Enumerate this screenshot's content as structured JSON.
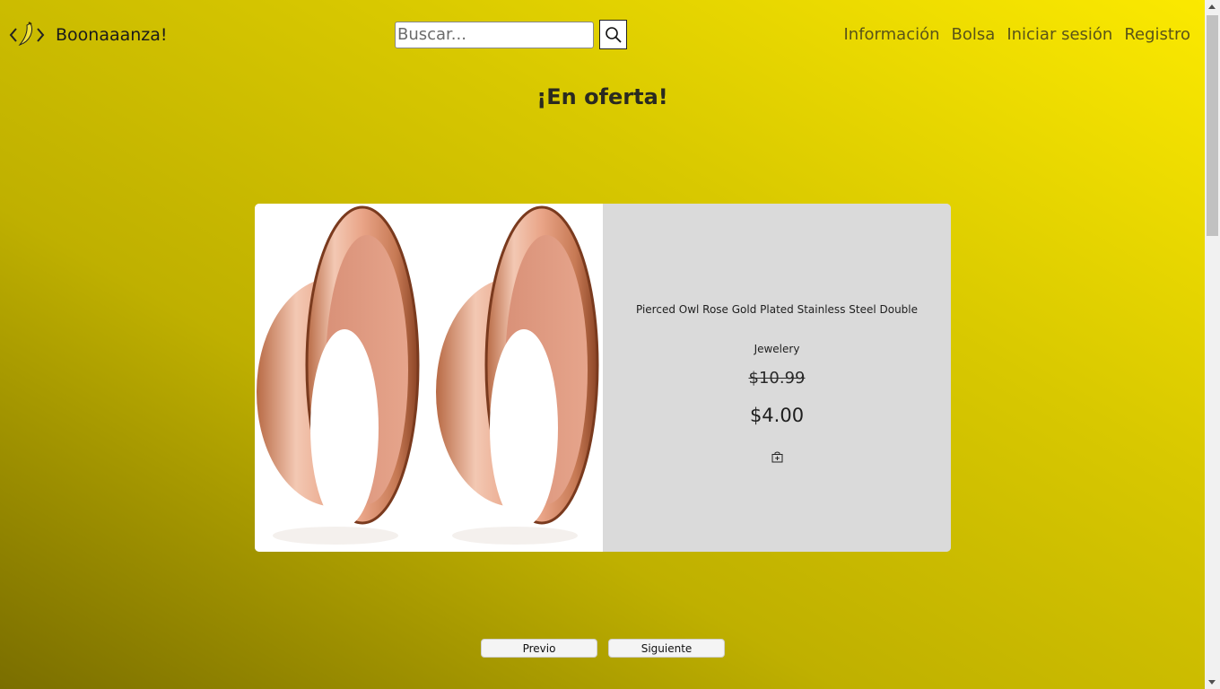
{
  "header": {
    "brand": "Boonaaanza!",
    "search_placeholder": "Buscar...",
    "nav": [
      {
        "label": "Información"
      },
      {
        "label": "Bolsa"
      },
      {
        "label": "Iniciar sesión"
      },
      {
        "label": "Registro"
      }
    ]
  },
  "section": {
    "title": "¡En oferta!"
  },
  "product": {
    "name": "Pierced Owl Rose Gold Plated Stainless Steel Double",
    "category": "Jewelery",
    "old_price": "$10.99",
    "price": "$4.00",
    "bag_icon": "bag-plus-icon"
  },
  "pager": {
    "prev_label": "Previo",
    "next_label": "Siguiente"
  },
  "colors": {
    "gradient_dark": "#7a6e00",
    "gradient_light": "#fbe900",
    "card_bg": "#dadada"
  }
}
